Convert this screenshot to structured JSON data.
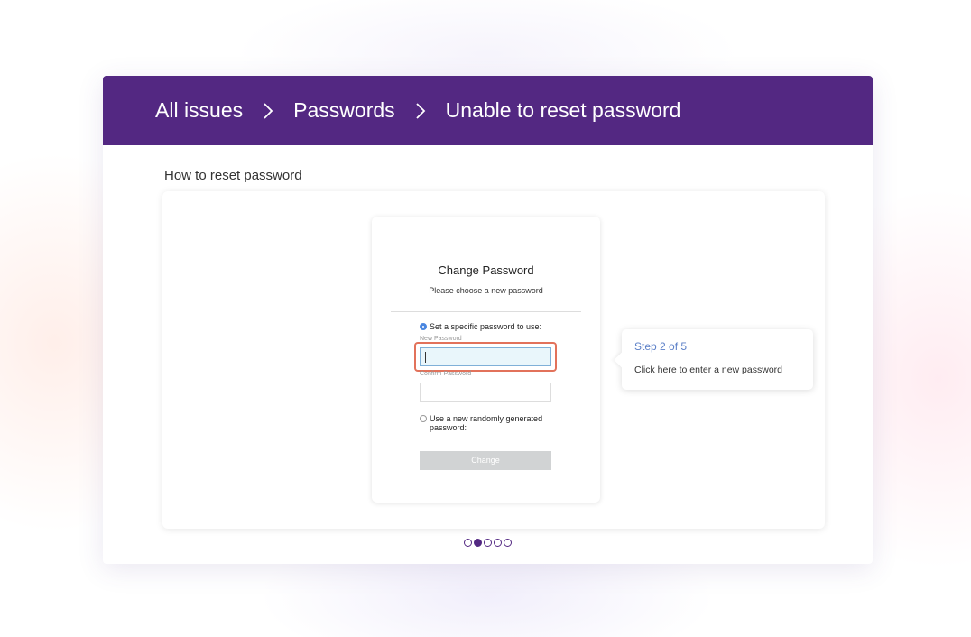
{
  "header": {
    "breadcrumbs": [
      "All issues",
      "Passwords",
      "Unable to reset password"
    ]
  },
  "section_title": "How to reset password",
  "mock_dialog": {
    "title": "Change Password",
    "subtitle": "Please choose a new password",
    "option_specific": "Set a specific password to use:",
    "new_password_label": "New Password",
    "new_password_value": "",
    "confirm_password_label": "Confirm Password",
    "confirm_password_value": "",
    "option_random": "Use a new randomly generated password:",
    "change_button": "Change"
  },
  "tooltip": {
    "step": "Step 2 of 5",
    "text": "Click here to enter a new password"
  },
  "pager": {
    "total": 5,
    "current": 2
  },
  "colors": {
    "brand": "#532882",
    "highlight": "#e2725b",
    "step_text": "#5b7fc7"
  }
}
